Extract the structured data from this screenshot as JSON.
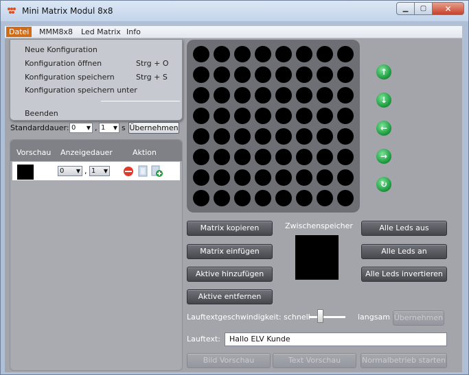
{
  "window": {
    "title": "Mini Matrix Modul 8x8"
  },
  "menu": [
    {
      "label": "Datei",
      "active": true
    },
    {
      "label": "MMM8x8"
    },
    {
      "label": "Led Matrix"
    },
    {
      "label": "Info"
    }
  ],
  "file_menu": {
    "items": [
      {
        "label": "Neue Konfiguration",
        "shortcut": ""
      },
      {
        "label": "Konfiguration öffnen",
        "shortcut": "Strg + O"
      },
      {
        "label": "Konfiguration speichern",
        "shortcut": "Strg + S"
      },
      {
        "label": "Konfiguration speichern unter",
        "shortcut": ""
      },
      {
        "label": "Beenden",
        "shortcut": ""
      }
    ]
  },
  "standard": {
    "label": "Standarddauer:",
    "value1": "0",
    "sep": ",",
    "value2": "1",
    "unit": "s",
    "apply": "Übernehmen"
  },
  "list": {
    "headers": [
      "Vorschau",
      "Anzeigedauer",
      "Aktion"
    ],
    "row": {
      "value1": "0",
      "sep": ",",
      "value2": "1"
    }
  },
  "matrix": {
    "rows": 8,
    "cols": 8
  },
  "arrows": [
    "up-arrow-icon",
    "down-arrow-icon",
    "left-arrow-icon",
    "right-arrow-icon",
    "rotate-icon"
  ],
  "buttons": {
    "copy": "Matrix kopieren",
    "paste": "Matrix einfügen",
    "add": "Aktive hinzufügen",
    "remove": "Aktive entfernen",
    "all_off": "Alle Leds aus",
    "all_on": "Alle Leds an",
    "invert": "Alle Leds invertieren"
  },
  "clipboard_label": "Zwischenspeicher",
  "speed": {
    "label": "Lauftextgeschwindigkeit: schnell",
    "slow": "langsam",
    "apply": "Übernehmen",
    "position": 0.25
  },
  "scrolltext": {
    "label": "Lauftext:",
    "value": "Hallo ELV Kunde"
  },
  "bottom": {
    "preview_image": "Bild Vorschau",
    "preview_text": "Text Vorschau",
    "normal": "Normalbetrieb starten"
  },
  "colors": {
    "menu_active": "#d26b14",
    "button": "#55575c",
    "arrow": "#1c9a3e"
  }
}
